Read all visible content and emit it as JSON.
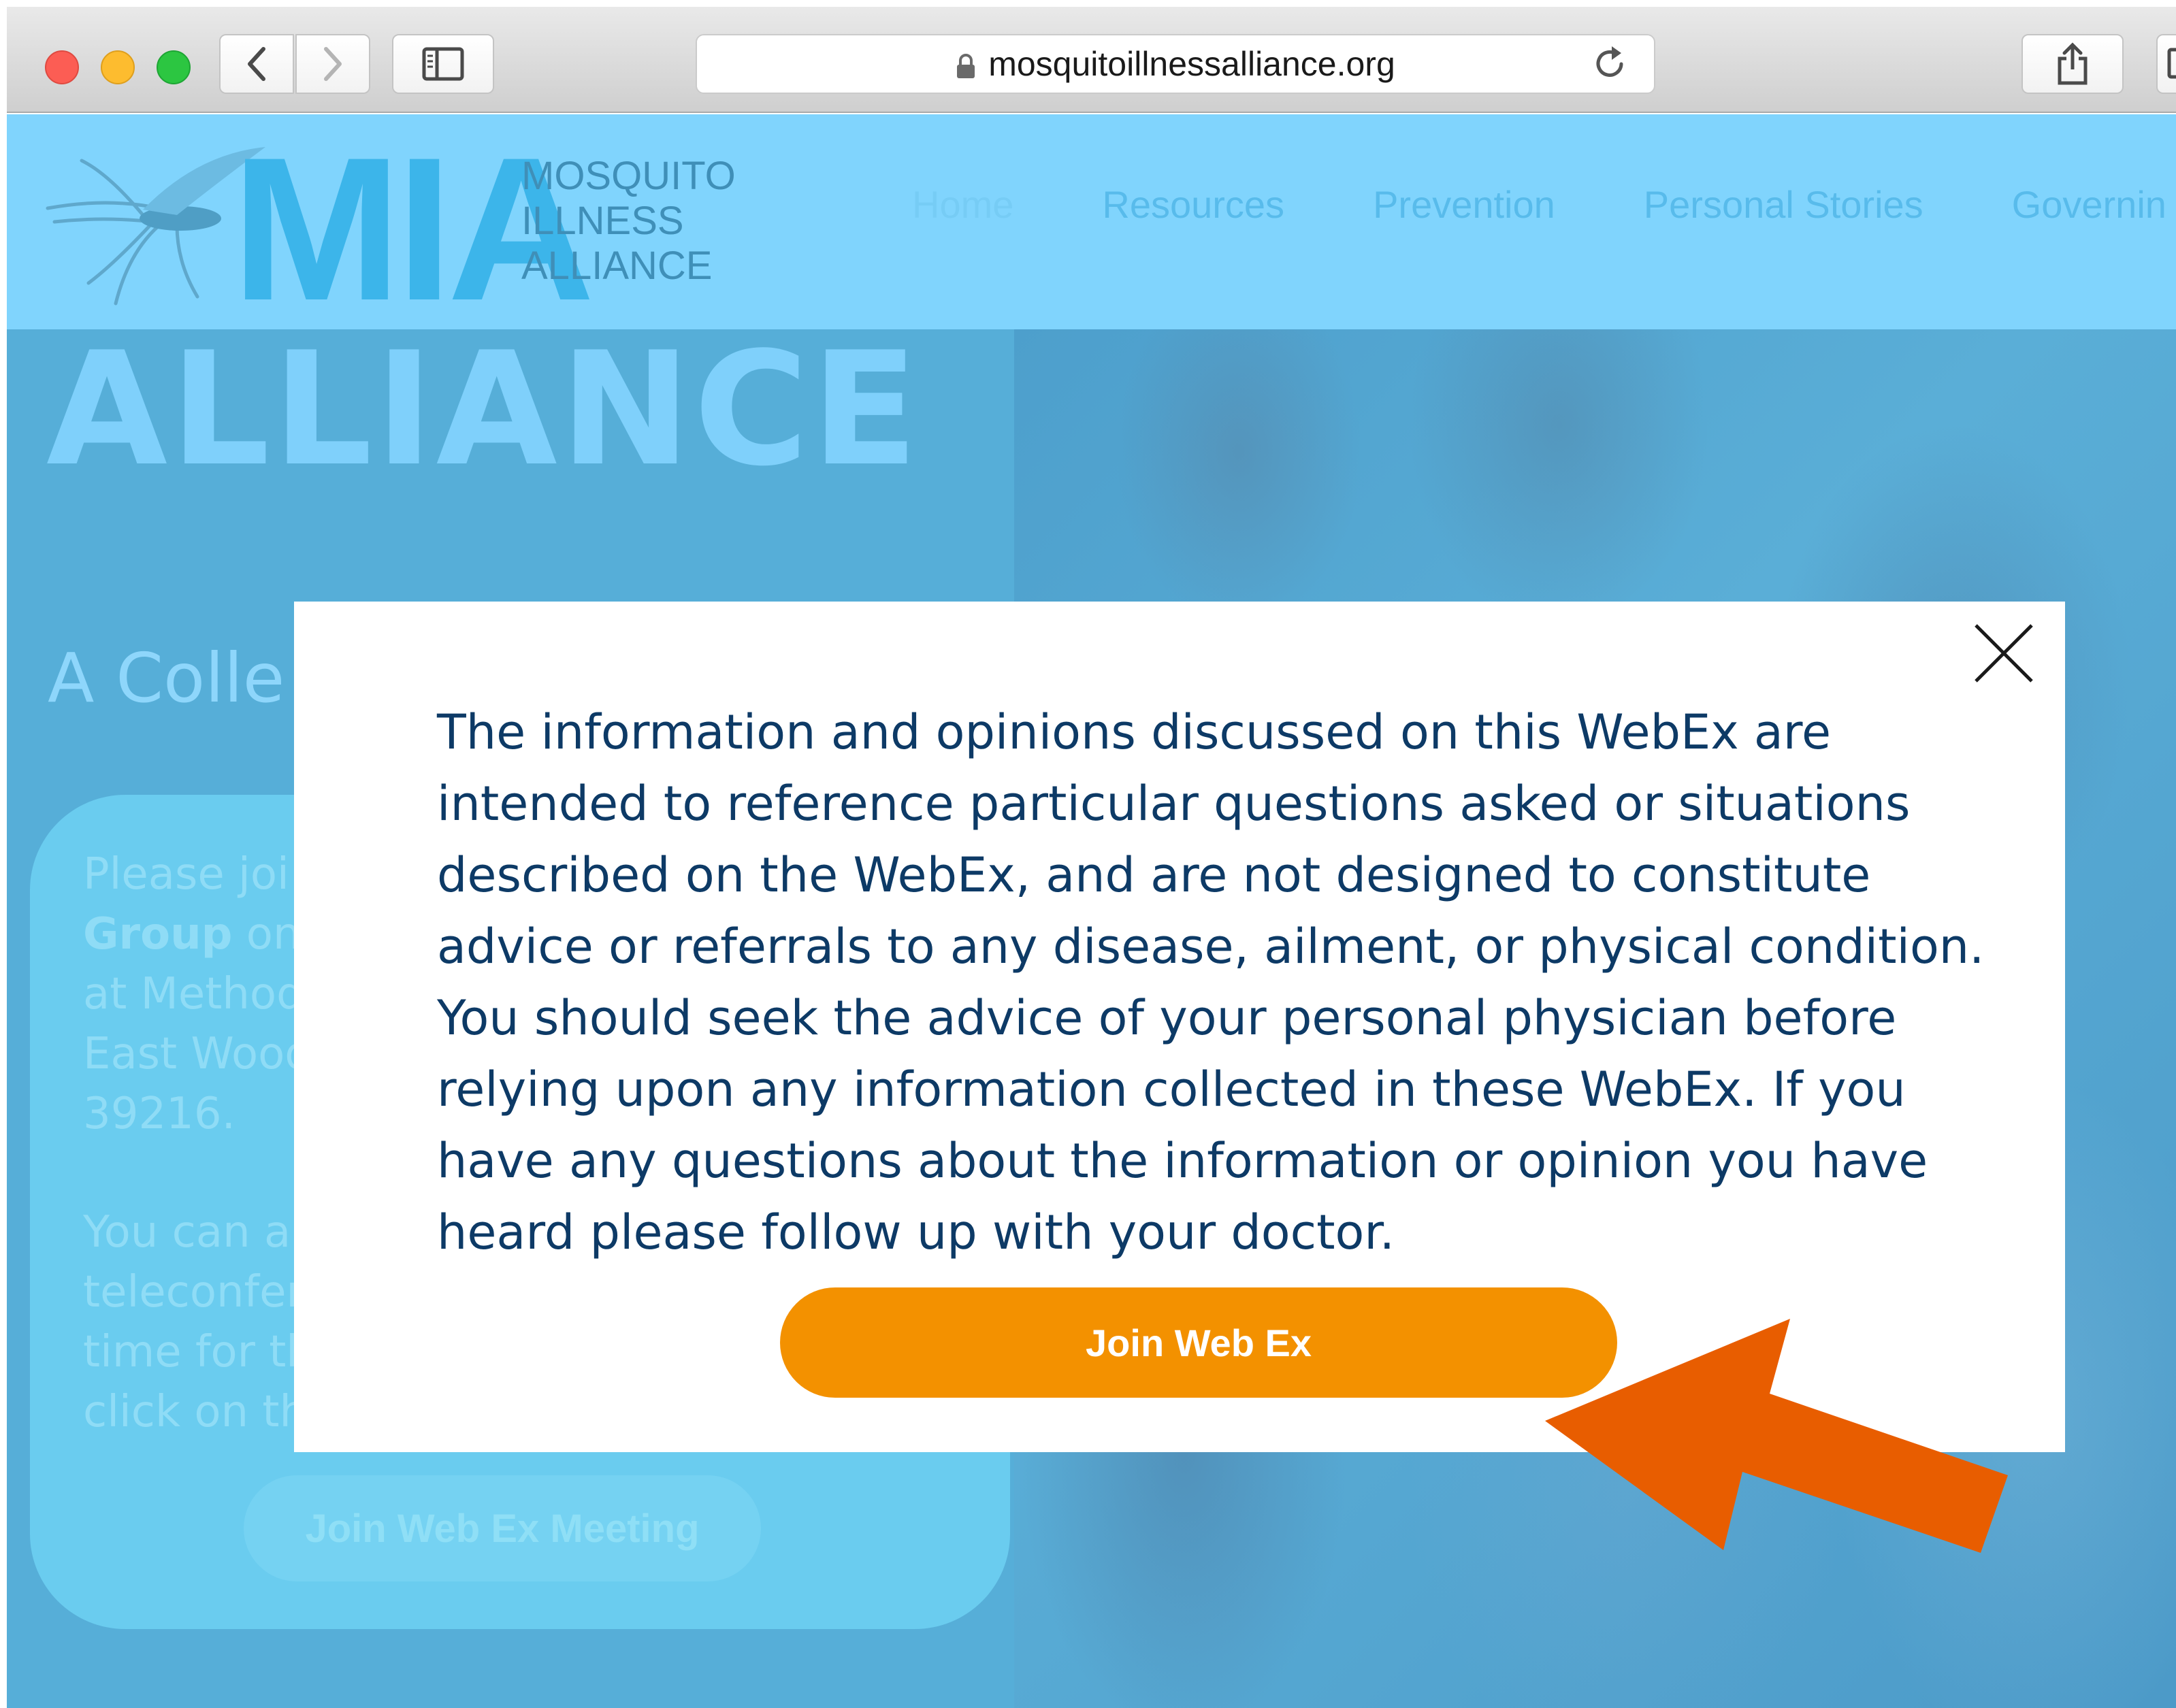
{
  "browser": {
    "url": "mosquitoillnessalliance.org",
    "icons": [
      "back-icon",
      "forward-icon",
      "sidebar-icon",
      "lock-icon",
      "reload-icon",
      "share-icon"
    ]
  },
  "site": {
    "logo": {
      "letters": "MIA",
      "words": [
        "MOSQUITO",
        "ILLNESS",
        "ALLIANCE"
      ]
    },
    "nav": [
      "Home",
      "Resources",
      "Prevention",
      "Personal Stories",
      "Governin"
    ],
    "hero_title": "ALLIANCE",
    "hero_subtitle": "A Colle",
    "card": {
      "lines": [
        "Please joi",
        "on",
        "at Method",
        "East Wood",
        "39216.",
        "You can al",
        "teleconfer",
        "time for the meeting, come back here and",
        "click on the link below to join."
      ],
      "bold_word": "Group",
      "button_label": "Join Web Ex Meeting"
    }
  },
  "modal": {
    "disclaimer": "The information and opinions discussed on this WebEx are\nintended to reference particular questions asked or situations\ndescribed on the WebEx, and are not designed to constitute\nadvice or referrals to any disease, ailment, or physical condition.\nYou should seek the advice of your personal physician before\nrelying upon any information collected in these WebEx.  If you\nhave any questions about the information or opinion you have\nheard please follow up with your doctor.",
    "join_label": "Join Web Ex",
    "close_icon": "close-icon"
  },
  "colors": {
    "modal_text": "#0d3a66",
    "join_button": "#f39100",
    "arrow": "#e85d00",
    "header": "#80d4fd",
    "overlay": "#56aed8"
  }
}
